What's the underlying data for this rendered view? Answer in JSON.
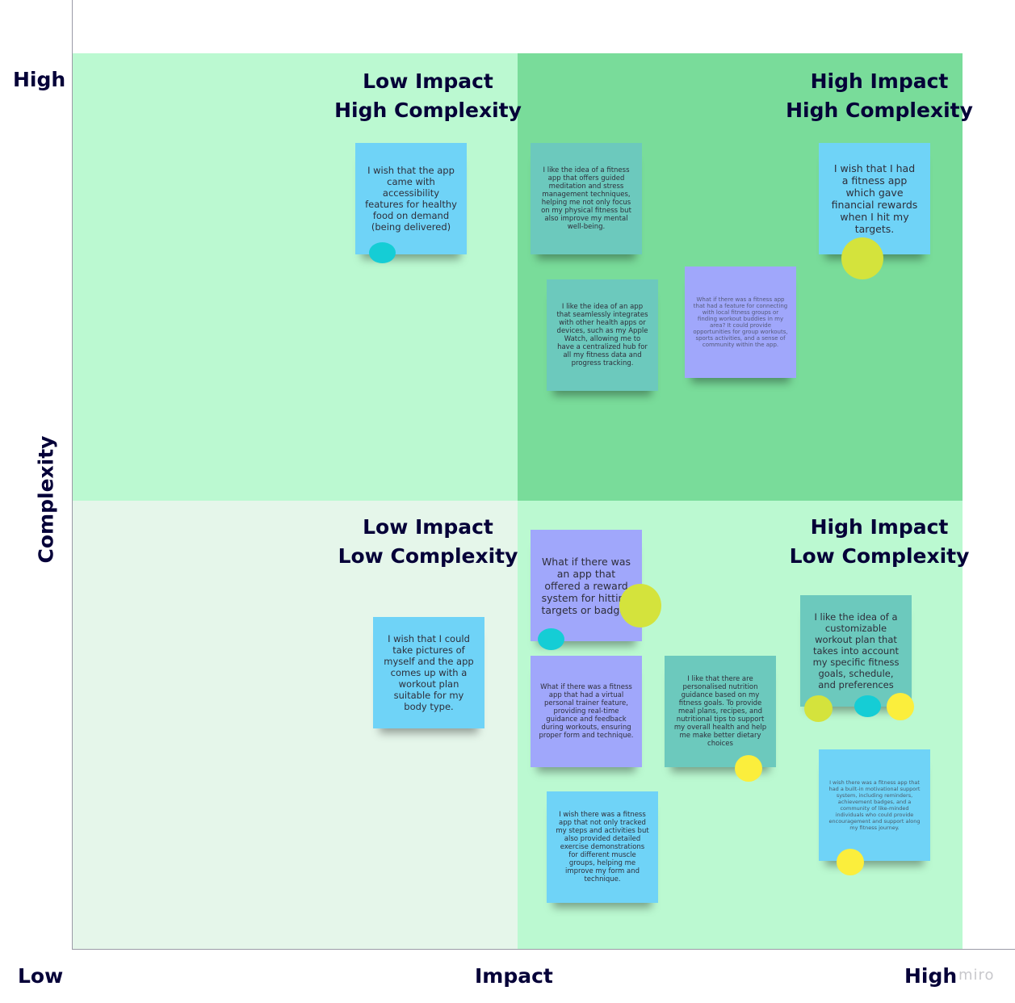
{
  "axes": {
    "y_label": "Complexity",
    "y_high": "High",
    "x_label": "Impact",
    "x_low": "Low",
    "x_high": "High"
  },
  "quadrants": {
    "top_left": {
      "title_1": "Low Impact",
      "title_2": "High Complexity",
      "color": "#bbf9d1"
    },
    "top_right": {
      "title_1": "High Impact",
      "title_2": "High Complexity",
      "color": "#79dc9a"
    },
    "bottom_left": {
      "title_1": "Low Impact",
      "title_2": "Low Complexity",
      "color": "#e5f6ea"
    },
    "bottom_right": {
      "title_1": "High Impact",
      "title_2": "Low Complexity",
      "color": "#bbf9d1"
    }
  },
  "notes": [
    {
      "text": "I wish that the app came with accessibility features for healthy food on demand (being delivered)",
      "color": "#6fd3f7"
    },
    {
      "text": "I like the idea of a fitness app that offers guided meditation and stress management techniques, helping me not only focus on my physical fitness but also improve my mental well-being.",
      "color": "#6cc9bd"
    },
    {
      "text": "I wish that I had a fitness app which gave financial rewards when I hit my targets.",
      "color": "#6fd3f7"
    },
    {
      "text": "I like the idea of an app that seamlessly integrates with other health apps or devices, such as my Apple Watch, allowing me to have a centralized hub for all my fitness data and progress tracking.",
      "color": "#6cc9bd"
    },
    {
      "text": "What if there was a fitness app that had a feature for connecting with local fitness groups or finding workout buddies in my area? It could provide opportunities for group workouts, sports activities, and a sense of community within the app.",
      "color": "#a0a7fb"
    },
    {
      "text": "What if there was an app that offered a reward system for hitting targets or badges",
      "color": "#a0a7fb"
    },
    {
      "text": "I wish that I could take pictures of myself and the app comes up with a workout plan suitable for my body type.",
      "color": "#6fd3f7"
    },
    {
      "text": "I like the idea of a customizable workout plan that takes into account my specific fitness goals, schedule, and preferences",
      "color": "#6cc9bd"
    },
    {
      "text": "What if there was a fitness app that had a virtual personal trainer feature, providing real-time guidance and feedback during workouts, ensuring proper form and technique.",
      "color": "#a0a7fb"
    },
    {
      "text": "I like that there are personalised nutrition guidance based on my fitness goals. To provide meal plans, recipes, and nutritional tips to support my overall health and help me make better dietary choices",
      "color": "#6cc9bd"
    },
    {
      "text": "I wish there was a fitness app that had a built-in motivational support system, including reminders, achievement badges, and a community of like-minded individuals who could provide encouragement and support along my fitness journey.",
      "color": "#6fd3f7"
    },
    {
      "text": "I wish there was a fitness app that not only tracked my steps and activities but also provided detailed exercise demonstrations for different muscle groups, helping me improve my form and technique.",
      "color": "#6fd3f7"
    }
  ],
  "vote_dot_colors": {
    "cyan": "#15cdd5",
    "lime": "#d4e33c",
    "yellow": "#fbee3c"
  },
  "watermark": "miro"
}
